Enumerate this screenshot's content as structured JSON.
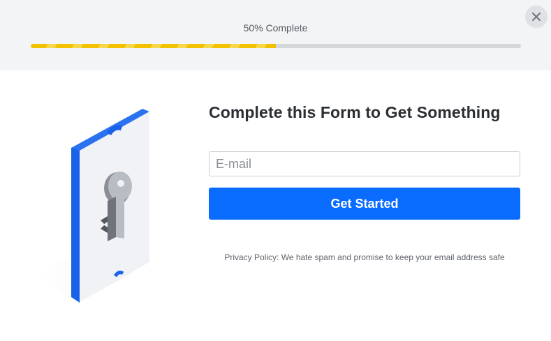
{
  "progress": {
    "label": "50% Complete",
    "percent": 50,
    "fill_color": "#f2c200"
  },
  "close_icon": "close-icon",
  "illustration": {
    "icon": "key-icon",
    "accent_color": "#1a63e8"
  },
  "form": {
    "headline": "Complete this Form to Get Something",
    "email_placeholder": "E-mail",
    "email_value": "",
    "submit_label": "Get Started",
    "button_color": "#0a6cff",
    "privacy_text": "Privacy Policy: We hate spam and promise to keep your email address safe"
  }
}
